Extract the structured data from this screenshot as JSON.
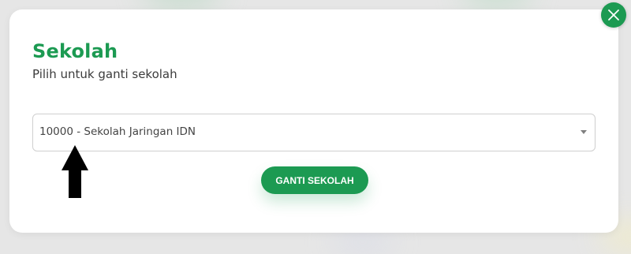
{
  "modal": {
    "title": "Sekolah",
    "subtitle": "Pilih untuk ganti sekolah"
  },
  "school_select": {
    "selected_value": "10000 - Sekolah Jaringan IDN",
    "caret_icon": "caret-down-icon"
  },
  "actions": {
    "submit_label": "GANTI SEKOLAH",
    "close_icon": "close-icon"
  },
  "colors": {
    "accent": "#1c9a52",
    "annotation_arrow": "#000000"
  },
  "annotation": {
    "icon": "arrow-up-icon"
  }
}
